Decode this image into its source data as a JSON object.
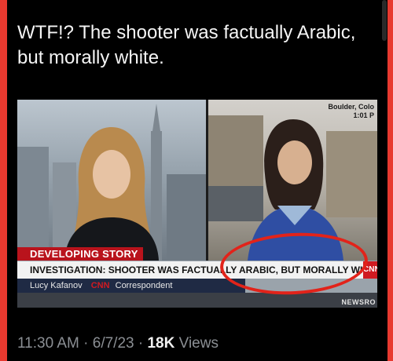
{
  "tweet": {
    "text": "WTF!? The shooter was factually Arabic, but morally white."
  },
  "broadcast": {
    "location": "Boulder, Colo",
    "time": "1:01 P",
    "banner": "DEVELOPING STORY",
    "headline": "INVESTIGATION: SHOOTER WAS FACTUALLY ARABIC, BUT MORALLY WHITE",
    "reporter_name": "Lucy Kafanov",
    "network": "CNN",
    "reporter_role": "Correspondent",
    "bug": "CNN",
    "watermark": "NEWSRO"
  },
  "meta": {
    "time": "11:30 AM",
    "separator": "·",
    "date": "6/7/23",
    "views_count": "18K",
    "views_label": "Views"
  },
  "colors": {
    "frame": "#e8392f",
    "cnn_red": "#d01a21",
    "annotation_circle": "#e2231a"
  }
}
